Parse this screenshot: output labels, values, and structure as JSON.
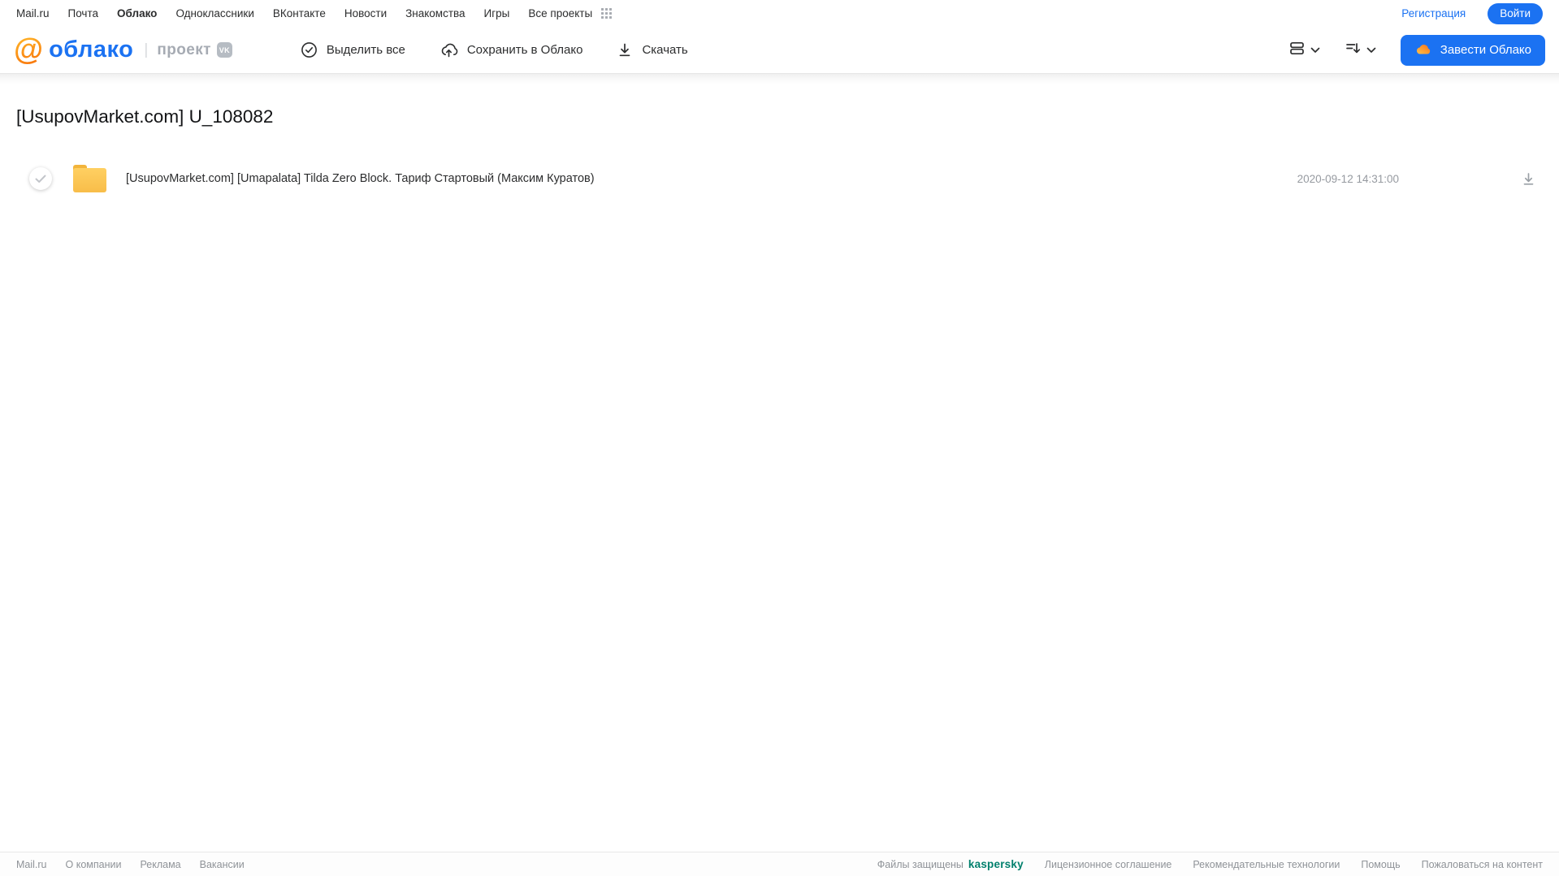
{
  "portal_nav": {
    "links": [
      "Mail.ru",
      "Почта",
      "Облако",
      "Одноклассники",
      "ВКонтакте",
      "Новости",
      "Знакомства",
      "Игры",
      "Все проекты"
    ],
    "registration_label": "Регистрация",
    "login_label": "Войти"
  },
  "header": {
    "logo_word": "облако",
    "logo_divider": "|",
    "project_label": "проект",
    "vk_badge": "VK",
    "toolbar": {
      "select_all_label": "Выделить все",
      "save_to_cloud_label": "Сохранить в Облако",
      "download_label": "Скачать"
    },
    "create_cloud_label": "Завести Облако"
  },
  "main": {
    "title": "[UsupovMarket.com] U_108082",
    "files": [
      {
        "name": "[UsupovMarket.com] [Umapalata] Tilda Zero Block. Тариф Стартовый (Максим Куратов)",
        "date": "2020-09-12 14:31:00"
      }
    ]
  },
  "footer": {
    "left_links": [
      "Mail.ru",
      "О компании",
      "Реклама",
      "Вакансии"
    ],
    "protected_by_label": "Файлы защищены",
    "kaspersky_label": "kaspersky",
    "right_links": [
      "Лицензионное соглашение",
      "Рекомендательные технологии",
      "Помощь",
      "Пожаловаться на контент"
    ]
  },
  "colors": {
    "accent_blue": "#1b72f2",
    "logo_orange": "#f97c0e",
    "folder_yellow": "#f8bd49",
    "kaspersky_green": "#00806d",
    "muted_gray": "#969aa0"
  }
}
